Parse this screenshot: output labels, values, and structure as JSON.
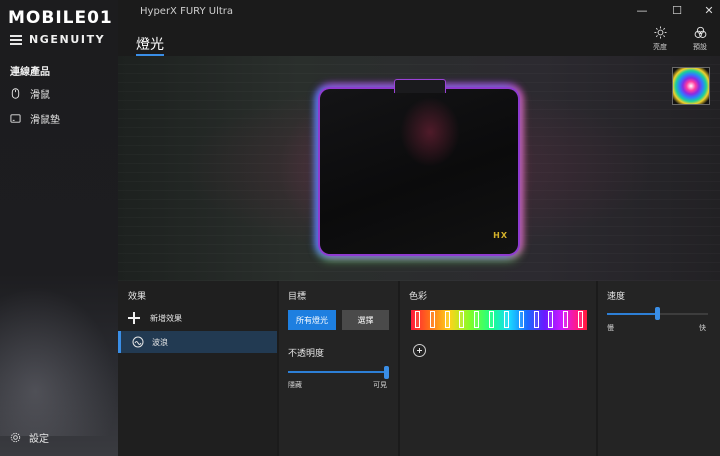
{
  "sidebar": {
    "logo": "MOBILE01",
    "brand": "NGENUITY",
    "section_title": "連線產品",
    "items": [
      {
        "label": "滑鼠",
        "icon": "mouse-icon"
      },
      {
        "label": "滑鼠墊",
        "icon": "mousepad-icon"
      }
    ],
    "settings_label": "設定"
  },
  "titlebar": {
    "window_title": "HyperX FURY Ultra",
    "minimize": "—",
    "maximize": "☐",
    "close": "✕"
  },
  "page": {
    "title": "燈光"
  },
  "top_actions": [
    {
      "label": "亮度",
      "icon": "brightness-icon"
    },
    {
      "label": "預設",
      "icon": "presets-icon"
    }
  ],
  "preview": {
    "logo_text": "HX"
  },
  "effects": {
    "title": "效果",
    "add_label": "新增效果",
    "items": [
      {
        "label": "波浪",
        "icon": "wave-icon"
      }
    ]
  },
  "target": {
    "title": "目標",
    "all_lights_label": "所有燈光",
    "select_label": "選擇",
    "opacity_title": "不透明度",
    "opacity_value": 1.0,
    "min_label": "隱藏",
    "max_label": "可見"
  },
  "color": {
    "title": "色彩",
    "marker_count": 12
  },
  "speed": {
    "title": "速度",
    "value": 0.5,
    "min_label": "慢",
    "max_label": "快"
  },
  "colors": {
    "accent": "#1e7fe0",
    "selected_row": "#223a52",
    "panel_bg": "#242424",
    "sidebar_bg": "#1c1c1e"
  }
}
